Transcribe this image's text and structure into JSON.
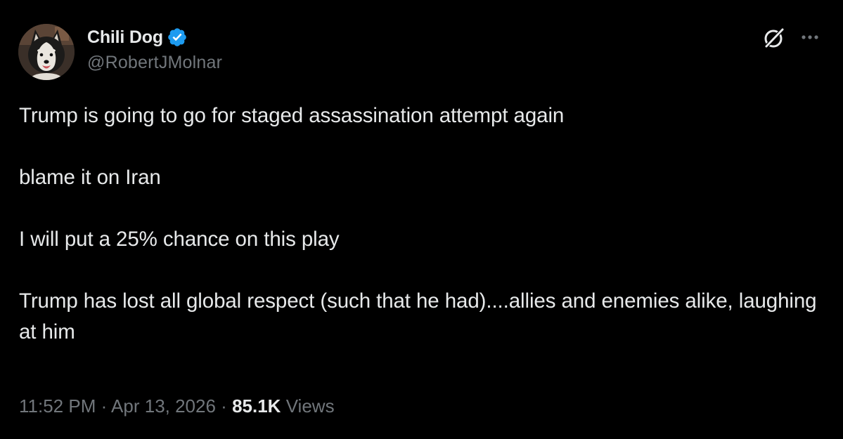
{
  "author": {
    "display_name": "Chili Dog",
    "handle": "@RobertJMolnar",
    "verified": true,
    "verified_color": "#1d9bf0"
  },
  "header_icons": {
    "grok": "grok-icon",
    "more": "more-icon"
  },
  "tweet": {
    "paragraphs": [
      "Trump is going to go for staged assassination attempt again",
      "blame it on Iran",
      "I will put a 25% chance on this play",
      "Trump has lost all global respect (such that he had)....allies and enemies alike, laughing at him"
    ]
  },
  "meta": {
    "time": "11:52 PM",
    "separator": "·",
    "date": "Apr 13, 2026",
    "views_count": "85.1K",
    "views_label": "Views"
  },
  "colors": {
    "background": "#000000",
    "text_primary": "#e7e9ea",
    "text_secondary": "#71767b"
  }
}
